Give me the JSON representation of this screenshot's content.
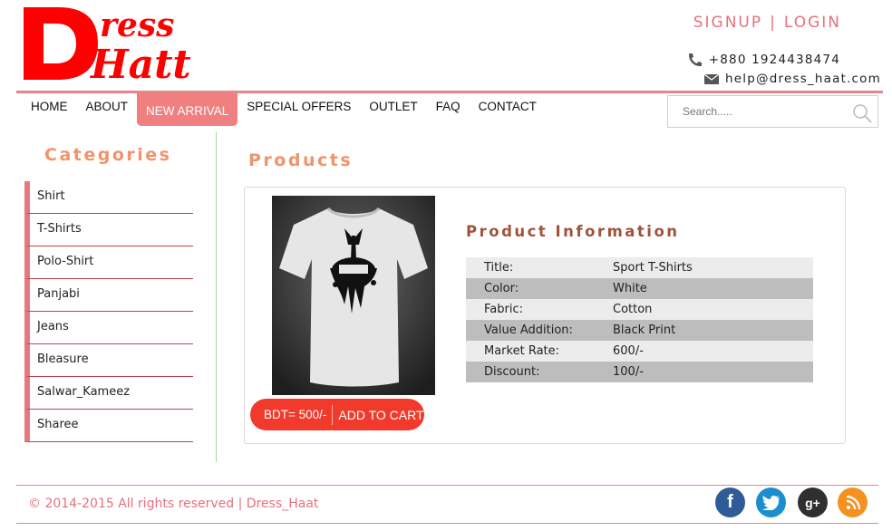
{
  "brand": {
    "logo_top": "ress",
    "logo_bottom": "Hatt",
    "logo_initial": "D"
  },
  "header": {
    "signup": "SIGNUP",
    "separator": "|",
    "login": "LOGIN",
    "phone": "+880 1924438474",
    "email": "help@dress_haat.com"
  },
  "nav": {
    "items": [
      {
        "label": "HOME"
      },
      {
        "label": "ABOUT"
      },
      {
        "label": "NEW ARRIVAL",
        "active": true
      },
      {
        "label": "SPECIAL OFFERS"
      },
      {
        "label": "OUTLET"
      },
      {
        "label": "FAQ"
      },
      {
        "label": "CONTACT"
      }
    ]
  },
  "search": {
    "placeholder": "Search....."
  },
  "sidebar": {
    "title": "Categories",
    "items": [
      "Shirt",
      "T-Shirts",
      "Polo-Shirt",
      "Panjabi",
      "Jeans",
      "Bleasure",
      "Salwar_Kameez",
      "Sharee"
    ]
  },
  "products": {
    "title": "Products",
    "price_label": "BDT= 500/-",
    "add_to_cart": "ADD TO CART",
    "info_title": "Product Information",
    "info": [
      {
        "key": "Title:",
        "value": "Sport T-Shirts"
      },
      {
        "key": "Color:",
        "value": "White"
      },
      {
        "key": "Fabric:",
        "value": "Cotton"
      },
      {
        "key": "Value Addition:",
        "value": "Black Print"
      },
      {
        "key": "Market Rate:",
        "value": "600/-"
      },
      {
        "key": "Discount:",
        "value": "100/-"
      }
    ]
  },
  "footer": {
    "copyright": "© 2014-2015 All rights reserved | Dress_Haat",
    "social": [
      {
        "icon": "facebook-icon",
        "glyph": "f"
      },
      {
        "icon": "twitter-icon",
        "glyph": ""
      },
      {
        "icon": "google-plus-icon",
        "glyph": "g+"
      },
      {
        "icon": "rss-icon",
        "glyph": ""
      }
    ]
  },
  "colors": {
    "accent": "#e8858b",
    "logo_red": "#ff0000",
    "heading_orange": "#f0946b",
    "cart_red": "#f23a2c"
  }
}
